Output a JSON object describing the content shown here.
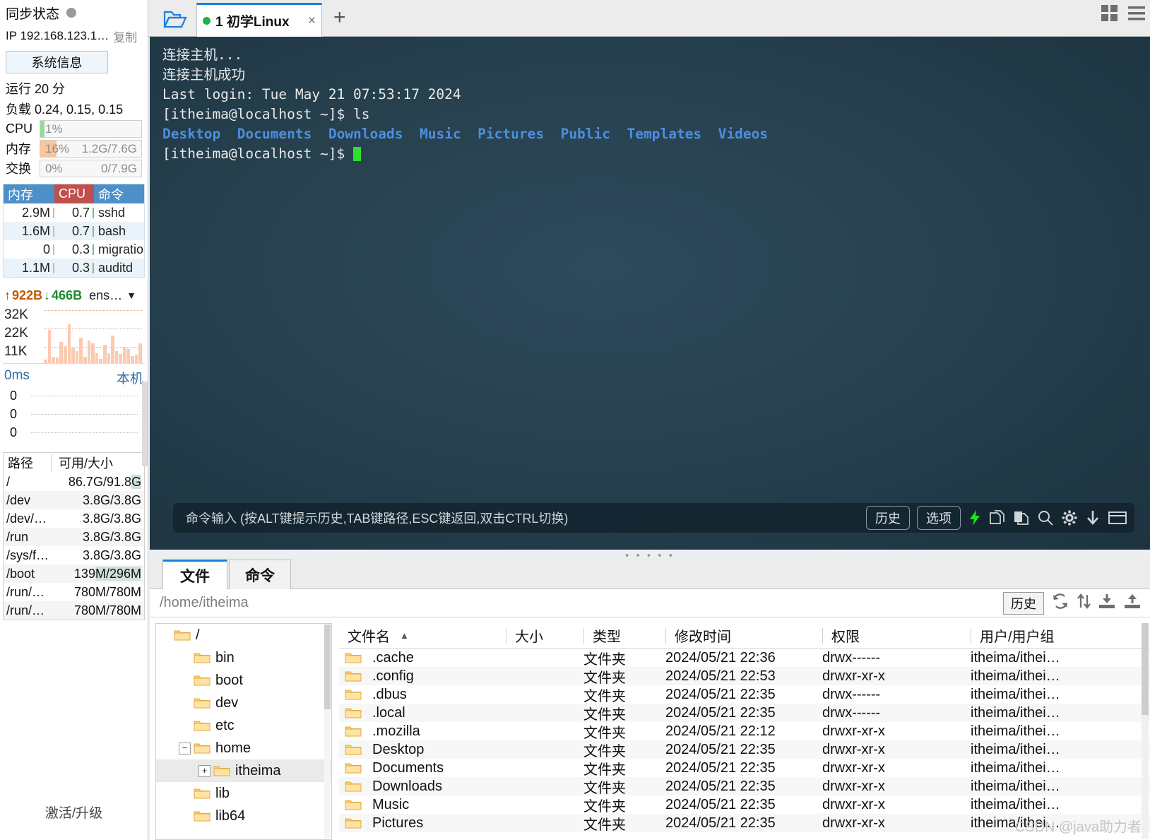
{
  "sidebar": {
    "sync_label": "同步状态",
    "ip_text": "IP 192.168.123.1…",
    "copy_label": "复制",
    "sysinfo_button": "系统信息",
    "uptime": "运行 20 分",
    "load": "负载 0.24, 0.15, 0.15",
    "meters": [
      {
        "name": "CPU",
        "pct": "1%",
        "value": "",
        "fill_color": "#9ad89a",
        "fill_width": "4%"
      },
      {
        "name": "内存",
        "pct": "16%",
        "value": "1.2G/7.6G",
        "fill_color": "#f9c59a",
        "fill_width": "16%"
      },
      {
        "name": "交换",
        "pct": "0%",
        "value": "0/7.9G",
        "fill_color": "#f9c59a",
        "fill_width": "0%"
      }
    ],
    "proc_headers": {
      "mem": "内存",
      "cpu": "CPU",
      "cmd": "命令"
    },
    "proc_rows": [
      {
        "mem": "2.9M",
        "cpu": "0.7",
        "cmd": "sshd"
      },
      {
        "mem": "1.6M",
        "cpu": "0.7",
        "cmd": "bash"
      },
      {
        "mem": "0",
        "cpu": "0.3",
        "cmd": "migratio"
      },
      {
        "mem": "1.1M",
        "cpu": "0.3",
        "cmd": "auditd"
      }
    ],
    "net": {
      "up_arrow": "↑",
      "up_value": "922B",
      "down_arrow": "↓",
      "down_value": "466B",
      "interface": "ens…",
      "y_labels": [
        "32K",
        "22K",
        "11K"
      ]
    },
    "latency": {
      "left_label": "0ms",
      "right_label": "本机",
      "y_labels": [
        "0",
        "0",
        "0"
      ]
    },
    "disk_headers": {
      "path": "路径",
      "size": "可用/大小"
    },
    "disk_rows": [
      {
        "path": "/",
        "size": "86.7G/91.8G",
        "highlight": "G"
      },
      {
        "path": "/dev",
        "size": "3.8G/3.8G",
        "highlight": ""
      },
      {
        "path": "/dev/…",
        "size": "3.8G/3.8G",
        "highlight": ""
      },
      {
        "path": "/run",
        "size": "3.8G/3.8G",
        "highlight": ""
      },
      {
        "path": "/sys/f…",
        "size": "3.8G/3.8G",
        "highlight": ""
      },
      {
        "path": "/boot",
        "size": "139M/296M",
        "highlight": "M/296M"
      },
      {
        "path": "/run/…",
        "size": "780M/780M",
        "highlight": ""
      },
      {
        "path": "/run/…",
        "size": "780M/780M",
        "highlight": ""
      }
    ],
    "activate": "激活/升级"
  },
  "tabbar": {
    "folder_icon": "open-folder-icon",
    "tabs": [
      {
        "title": "1 初学Linux",
        "status": "connected",
        "close": "×"
      }
    ],
    "new_tab": "+",
    "grid_icon": "grid-view-icon",
    "menu_icon": "hamburger-menu-icon"
  },
  "terminal": {
    "lines": [
      {
        "text": "连接主机...",
        "type": "plain"
      },
      {
        "text": "连接主机成功",
        "type": "plain"
      },
      {
        "text": "Last login: Tue May 21 07:53:17 2024",
        "type": "plain"
      },
      {
        "text": "[itheima@localhost ~]$ ls",
        "type": "plain"
      },
      {
        "text": "",
        "type": "files"
      },
      {
        "text": "[itheima@localhost ~]$ ",
        "type": "prompt"
      }
    ],
    "ls_output": [
      "Desktop",
      "Documents",
      "Downloads",
      "Music",
      "Pictures",
      "Public",
      "Templates",
      "Videos"
    ],
    "cmdbar": {
      "hint": "命令输入 (按ALT键提示历史,TAB键路径,ESC键返回,双击CTRL切换)",
      "history_btn": "历史",
      "options_btn": "选项",
      "icons": [
        "lightning-icon",
        "duplicate-icon",
        "copy-icon",
        "search-icon",
        "gear-icon",
        "download-icon",
        "window-icon"
      ]
    }
  },
  "filepanel": {
    "tabs": [
      {
        "label": "文件",
        "active": true
      },
      {
        "label": "命令",
        "active": false
      }
    ],
    "path": "/home/itheima",
    "history_btn": "历史",
    "tools": [
      "refresh-icon",
      "sort-icon",
      "download-icon",
      "upload-icon"
    ],
    "tree": [
      {
        "label": "/",
        "depth": 0,
        "expander": "",
        "selected": false
      },
      {
        "label": "bin",
        "depth": 1,
        "expander": "",
        "selected": false
      },
      {
        "label": "boot",
        "depth": 1,
        "expander": "",
        "selected": false
      },
      {
        "label": "dev",
        "depth": 1,
        "expander": "",
        "selected": false
      },
      {
        "label": "etc",
        "depth": 1,
        "expander": "",
        "selected": false
      },
      {
        "label": "home",
        "depth": 1,
        "expander": "−",
        "selected": false
      },
      {
        "label": "itheima",
        "depth": 2,
        "expander": "+",
        "selected": true
      },
      {
        "label": "lib",
        "depth": 1,
        "expander": "",
        "selected": false
      },
      {
        "label": "lib64",
        "depth": 1,
        "expander": "",
        "selected": false
      }
    ],
    "columns": [
      "文件名",
      "大小",
      "类型",
      "修改时间",
      "权限",
      "用户/用户组"
    ],
    "sort_column": "文件名",
    "sort_dir": "▲",
    "rows": [
      {
        "name": ".cache",
        "size": "",
        "type": "文件夹",
        "time": "2024/05/21 22:36",
        "perm": "drwx------",
        "user": "itheima/ithei…"
      },
      {
        "name": ".config",
        "size": "",
        "type": "文件夹",
        "time": "2024/05/21 22:53",
        "perm": "drwxr-xr-x",
        "user": "itheima/ithei…"
      },
      {
        "name": ".dbus",
        "size": "",
        "type": "文件夹",
        "time": "2024/05/21 22:35",
        "perm": "drwx------",
        "user": "itheima/ithei…"
      },
      {
        "name": ".local",
        "size": "",
        "type": "文件夹",
        "time": "2024/05/21 22:35",
        "perm": "drwx------",
        "user": "itheima/ithei…"
      },
      {
        "name": ".mozilla",
        "size": "",
        "type": "文件夹",
        "time": "2024/05/21 22:12",
        "perm": "drwxr-xr-x",
        "user": "itheima/ithei…"
      },
      {
        "name": "Desktop",
        "size": "",
        "type": "文件夹",
        "time": "2024/05/21 22:35",
        "perm": "drwxr-xr-x",
        "user": "itheima/ithei…"
      },
      {
        "name": "Documents",
        "size": "",
        "type": "文件夹",
        "time": "2024/05/21 22:35",
        "perm": "drwxr-xr-x",
        "user": "itheima/ithei…"
      },
      {
        "name": "Downloads",
        "size": "",
        "type": "文件夹",
        "time": "2024/05/21 22:35",
        "perm": "drwxr-xr-x",
        "user": "itheima/ithei…"
      },
      {
        "name": "Music",
        "size": "",
        "type": "文件夹",
        "time": "2024/05/21 22:35",
        "perm": "drwxr-xr-x",
        "user": "itheima/ithei…"
      },
      {
        "name": "Pictures",
        "size": "",
        "type": "文件夹",
        "time": "2024/05/21 22:35",
        "perm": "drwxr-xr-x",
        "user": "itheima/ithei…"
      }
    ],
    "watermark": "CSDN @java助力者"
  }
}
